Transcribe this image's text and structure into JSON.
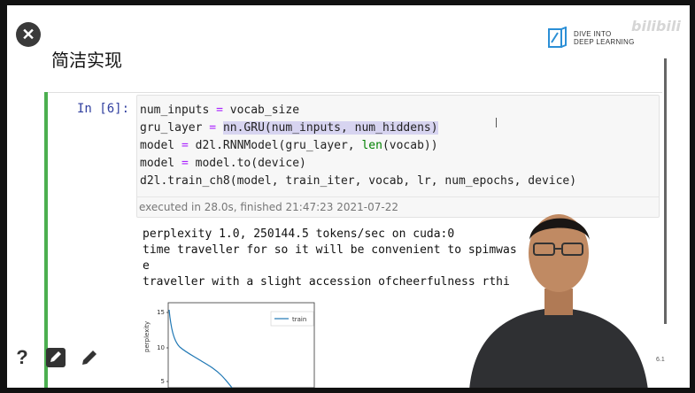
{
  "slide": {
    "title": "简洁实现",
    "logo_line1": "DIVE INTO",
    "logo_line2": "DEEP LEARNING",
    "watermark": "bilibili"
  },
  "cell": {
    "prompt": "In [6]:",
    "execution_info": "executed in 28.0s, finished 21:47:23 2021-07-22"
  },
  "output": {
    "lines": [
      "perplexity 1.0, 250144.5 tokens/sec on cuda:0",
      "time traveller for so it will be convenient to sp",
      "e",
      "traveller with a slight accession ofcheerfulness r"
    ],
    "line1_tail": "imwas",
    "line3_tail": "thi"
  },
  "plot": {
    "ylabel": "perplexity",
    "yticks": [
      "15",
      "10",
      "5"
    ],
    "legend": "train",
    "line_color": "#1f77b4"
  },
  "toolbar": {
    "page_indicator": "6.1"
  }
}
